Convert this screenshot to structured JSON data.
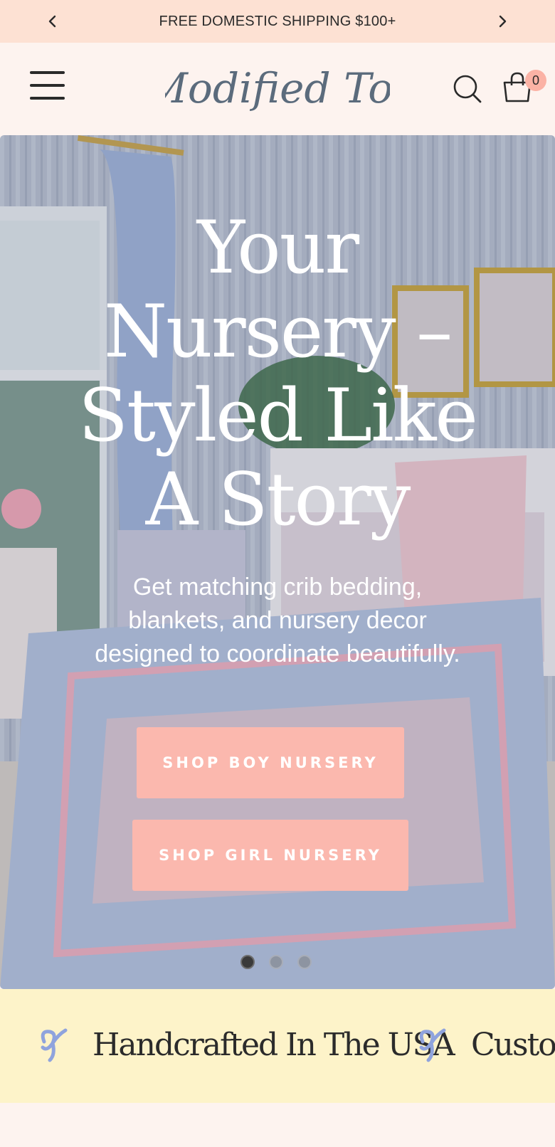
{
  "announcement": {
    "text": "FREE DOMESTIC SHIPPING $100+",
    "prev_icon": "chevron-left-icon",
    "next_icon": "chevron-right-icon"
  },
  "header": {
    "logo_text": "Modified Tot",
    "menu_icon": "hamburger-menu-icon",
    "search_icon": "search-icon",
    "cart_icon": "shopping-bag-icon",
    "cart_count": "0"
  },
  "hero": {
    "title_lines": [
      "Your",
      "Nursery –",
      "Styled Like",
      "A Story"
    ],
    "subtitle": "Get matching crib bedding, blankets, and nursery decor designed to coordinate beautifully.",
    "buttons": {
      "boy": "SHOP BOY NURSERY",
      "girl": "SHOP GIRL NURSERY"
    },
    "slides_total": 3,
    "active_slide": 1
  },
  "marquee": {
    "items": [
      {
        "icon": "ribbon-icon",
        "text": "Handcrafted In The USA"
      },
      {
        "icon": "ribbon-icon",
        "text": "Customi"
      }
    ]
  },
  "colors": {
    "announcement_bg": "#fde1d3",
    "page_bg": "#fdf3ef",
    "button_bg": "#fbb8ae",
    "badge_bg": "#fbb2a5",
    "marquee_bg": "#fdf3c9",
    "logo": "#5b6b7c",
    "ribbon": "#8fa3dd"
  }
}
